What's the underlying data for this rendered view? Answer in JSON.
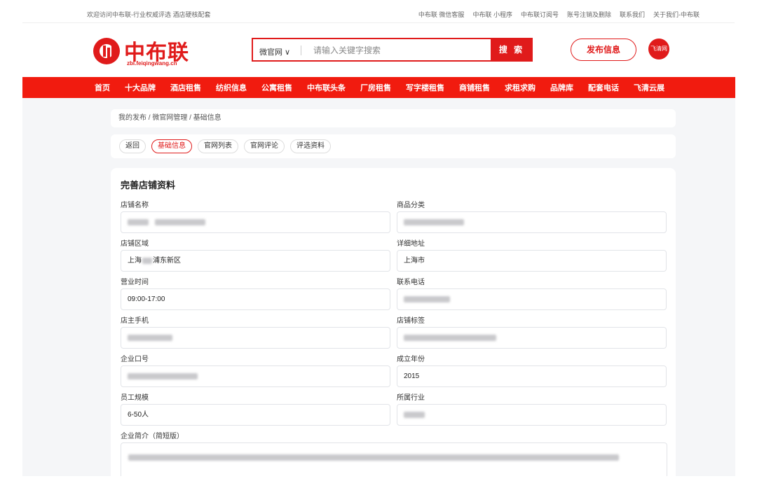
{
  "topbar": {
    "welcome": "欢迎访问中布联-行业权威评选 酒店硬核配套",
    "links": [
      "中布联 微信客服",
      "中布联 小程序",
      "中布联订阅号",
      "账号注销及删除",
      "联系我们",
      "关于我们-中布联"
    ]
  },
  "logo": {
    "name": "中布联",
    "domain": "zbl.feiqingwang.cn"
  },
  "search": {
    "scope": "微官网 ∨",
    "placeholder": "请输入关键字搜索",
    "button": "搜 索"
  },
  "header": {
    "publish": "发布信息",
    "avatar": "飞清网"
  },
  "nav": [
    "首页",
    "十大品牌",
    "酒店租售",
    "纺织信息",
    "公寓租售",
    "中布联头条",
    "厂房租售",
    "写字楼租售",
    "商铺租售",
    "求租求购",
    "品牌库",
    "配套电话",
    "飞清云展"
  ],
  "breadcrumb": "我的发布 / 微官网管理 / 基础信息",
  "tabs": [
    {
      "label": "返回",
      "active": false
    },
    {
      "label": "基础信息",
      "active": true
    },
    {
      "label": "官网列表",
      "active": false
    },
    {
      "label": "官网评论",
      "active": false
    },
    {
      "label": "评选资料",
      "active": false
    }
  ],
  "form": {
    "title": "完善店铺资料",
    "store_name_label": "店铺名称",
    "category_label": "商品分类",
    "region_label": "店铺区域",
    "region_value_prefix": "上海",
    "region_value_suffix": "浦东新区",
    "address_label": "详细地址",
    "address_value": "上海市",
    "hours_label": "营业时间",
    "hours_value": "09:00-17:00",
    "phone_label": "联系电话",
    "mobile_label": "店主手机",
    "tags_label": "店铺标签",
    "slogan_label": "企业口号",
    "founded_label": "成立年份",
    "founded_value": "2015",
    "staff_label": "员工规模",
    "staff_value": "6-50人",
    "industry_label": "所属行业",
    "intro_label": "企业简介（简短版）"
  }
}
